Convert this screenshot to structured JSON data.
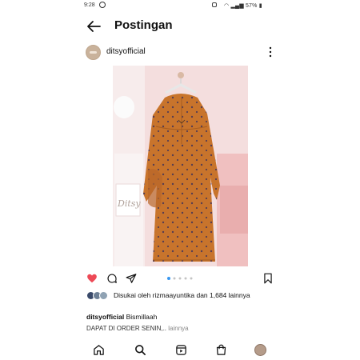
{
  "status_bar": {
    "time": "9:28",
    "battery": "57%"
  },
  "header": {
    "title": "Postingan"
  },
  "post": {
    "username": "ditsyofficial",
    "watermark": "Ditsy",
    "carousel": {
      "count": 5,
      "active_index": 0
    },
    "likes_text": "Disukai oleh rizmaayuntika dan 1,684 lainnya",
    "caption_user": "ditsyofficial",
    "caption_text": "Bismillaah",
    "caption_line2": "DAPAT DI ORDER SENIN,..",
    "caption_more": "lainnya"
  },
  "icons": {
    "back": "arrow-left-icon",
    "more": "more-vertical-icon",
    "like": "heart-icon",
    "comment": "comment-icon",
    "share": "send-icon",
    "save": "bookmark-icon",
    "home": "home-icon",
    "search": "search-icon",
    "reels": "reels-icon",
    "shop": "shop-icon"
  },
  "colors": {
    "like": "#ed4956",
    "dress": "#c8742c",
    "carousel_active": "#3897f0"
  }
}
